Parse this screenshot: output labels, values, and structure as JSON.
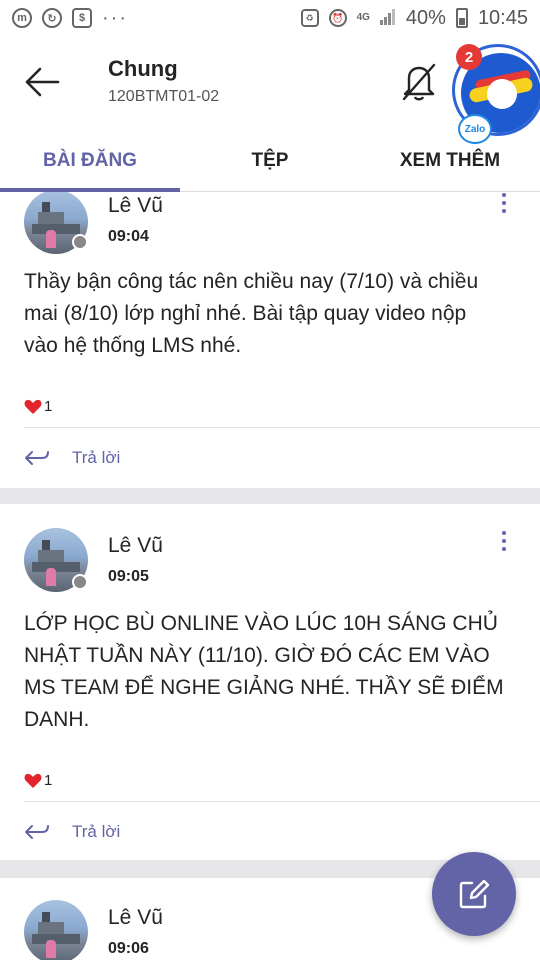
{
  "status_bar": {
    "battery": "40%",
    "time": "10:45",
    "network": "4G"
  },
  "header": {
    "title": "Chung",
    "subtitle": "120BTMT01-02"
  },
  "zalo_bubble": {
    "badge_count": "2",
    "label": "Zalo"
  },
  "tabs": [
    {
      "label": "BÀI ĐĂNG",
      "active": true
    },
    {
      "label": "TỆP",
      "active": false
    },
    {
      "label": "XEM THÊM",
      "active": false
    }
  ],
  "posts": [
    {
      "author": "Lê Vũ",
      "time": "09:04",
      "body": "Thầy bận công tác nên chiều nay (7/10) và chiều mai (8/10) lớp nghỉ nhé. Bài tập quay video nộp vào hệ thống LMS nhé.",
      "reaction_count": "1",
      "reply_label": "Trả lời"
    },
    {
      "author": "Lê Vũ",
      "time": "09:05",
      "body": "LỚP HỌC BÙ ONLINE VÀO LÚC 10H SÁNG CHỦ NHẬT TUẦN NÀY (11/10). GIỜ ĐÓ CÁC EM VÀO MS TEAM ĐỂ NGHE GIẢNG NHÉ. THẦY SẼ ĐIỂM DANH.",
      "reaction_count": "1",
      "reply_label": "Trả lời"
    },
    {
      "author": "Lê Vũ",
      "time": "09:06"
    }
  ],
  "colors": {
    "accent": "#6264a7",
    "reaction": "#e3242b"
  }
}
